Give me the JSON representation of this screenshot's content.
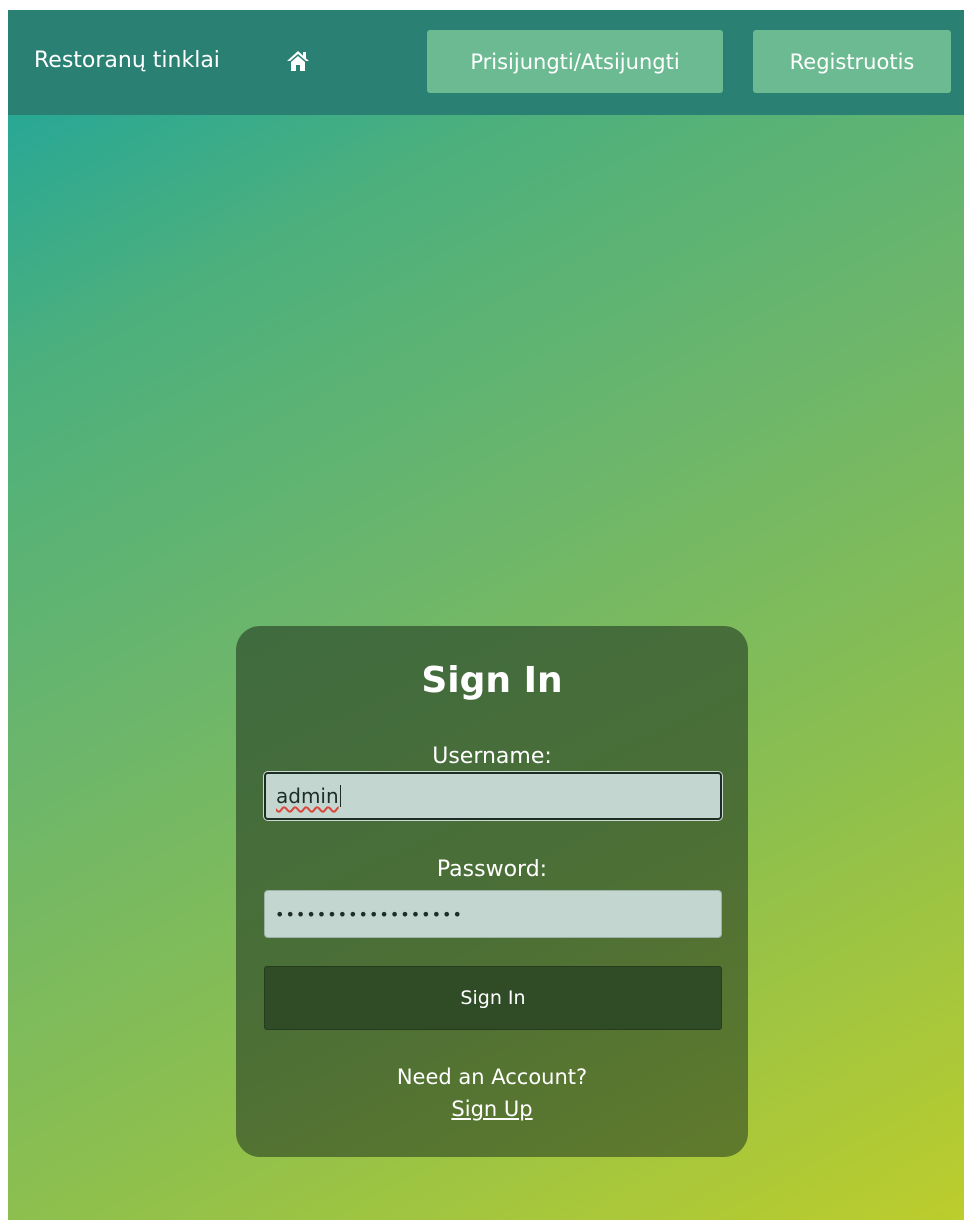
{
  "navbar": {
    "brand": "Restoranų tinklai",
    "home_icon": "home-icon",
    "login_logout": "Prisijungti/Atsijungti",
    "register": "Registruotis"
  },
  "signin": {
    "title": "Sign In",
    "username_label": "Username:",
    "username_value": "admin",
    "password_label": "Password:",
    "password_value": "••••••••••••••••••",
    "submit": "Sign In",
    "need_account": "Need an Account?",
    "signup_link": "Sign Up"
  },
  "colors": {
    "navbar": "#2a8072",
    "nav_button": "#6cba92",
    "card": "#4c6f36",
    "submit_button": "#2f4c26",
    "input": "#c4d6d0"
  }
}
